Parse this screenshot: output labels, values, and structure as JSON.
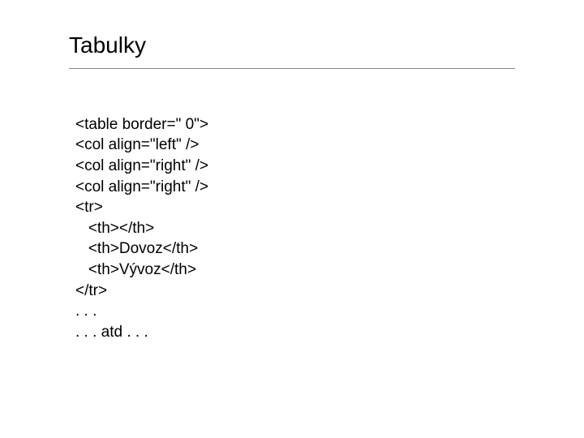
{
  "slide": {
    "title": "Tabulky",
    "lines": [
      "<table border=\" 0\">",
      "<col align=\"left\" />",
      "<col align=\"right\" />",
      "<col align=\"right\" />",
      "<tr>",
      "   <th></th>",
      "   <th>Dovoz</th>",
      "   <th>Vývoz</th>",
      "</tr>",
      ". . .",
      ". . . atd . . ."
    ]
  }
}
